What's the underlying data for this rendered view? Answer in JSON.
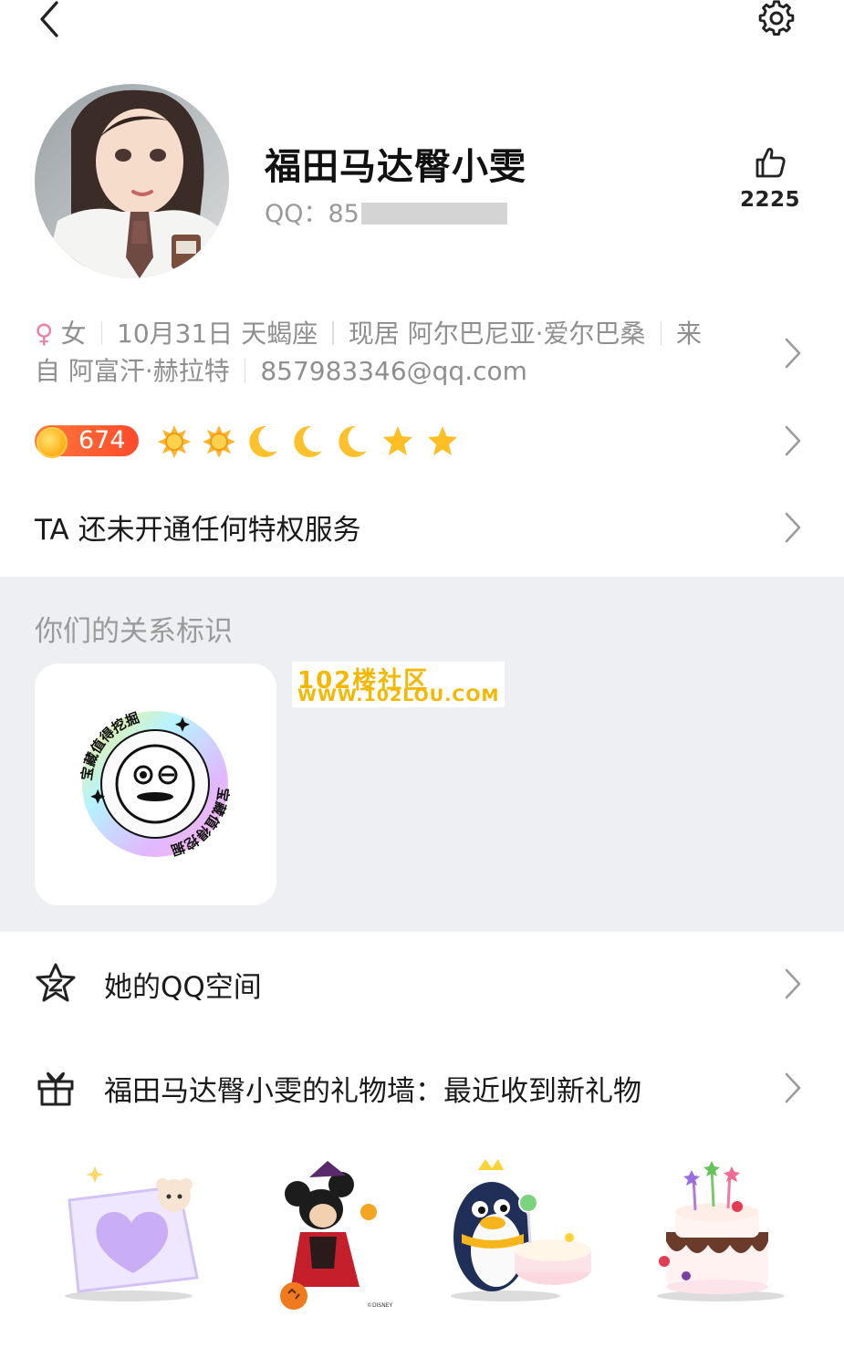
{
  "profile": {
    "nickname": "福田马达臀小雯",
    "qq_label": "QQ：85",
    "likes": "2225",
    "gender_symbol": "♀",
    "gender": "女",
    "birthday": "10月31日 天蝎座",
    "location": "现居 阿尔巴尼亚·爱尔巴桑",
    "hometown_part1": "来",
    "hometown_part2": "自 阿富汗·赫拉特",
    "email": "857983346@qq.com"
  },
  "level": {
    "value": "674",
    "icons": [
      "sun-icon",
      "sun-icon",
      "moon-icon",
      "moon-icon",
      "moon-icon",
      "star-icon",
      "star-icon"
    ]
  },
  "privilege": {
    "text": "TA 还未开通任何特权服务"
  },
  "relation": {
    "title": "你们的关系标识",
    "badge_text": "宝藏值得挖掘",
    "watermark_line1": "102楼社区",
    "watermark_line2": "WWW.102LOU.COM"
  },
  "rows": {
    "qzone": "她的QQ空间",
    "gift_wall": "福田马达臀小雯的礼物墙：最近收到新礼物"
  },
  "gifts": [
    "pillow-heart-gift",
    "minnie-halloween-gift",
    "penguin-cake-gift",
    "birthday-cake-gift"
  ],
  "gift_caption": "©DISNEY",
  "colors": {
    "accent_orange": "#ff5a2c",
    "section_gray": "#eeeff2",
    "muted_text": "#8f8f8f",
    "gender_pink": "#f27ea1"
  }
}
